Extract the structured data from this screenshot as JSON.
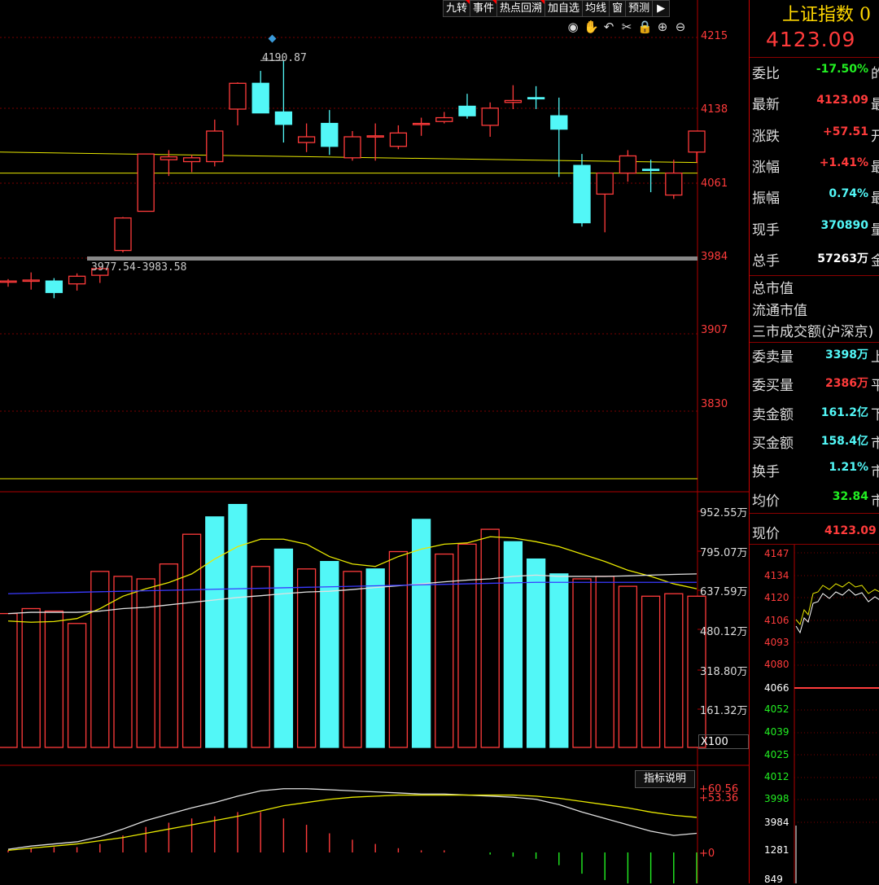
{
  "toolbar": {
    "buttons": [
      "九转",
      "事件",
      "热点回溯",
      "加自选",
      "均线",
      "窗",
      "预测"
    ],
    "exit_icon": "exit-right-icon"
  },
  "chart_tools": [
    "eye-icon",
    "hand-icon",
    "undo-icon",
    "scissors-icon",
    "lock-icon",
    "zoom-in-icon",
    "zoom-out-icon"
  ],
  "colors": {
    "up": "#ff3b3b",
    "down": "#52f7f7",
    "ma_yellow": "#e8e800",
    "ma_white": "#e0e0e0",
    "ma_blue": "#3a3aff",
    "grid": "#7a0000"
  },
  "chart_data": [
    {
      "type": "candlestick",
      "y_ticks": [
        "4215",
        "4138",
        "4061",
        "3984",
        "3907",
        "3830"
      ],
      "ylim": [
        3770,
        4240
      ],
      "annotations": {
        "high_label": "4190.87",
        "gap_label": "3977.54-3983.58"
      },
      "candles": [
        {
          "o": 3959,
          "h": 3962,
          "l": 3954,
          "c": 3960
        },
        {
          "o": 3960,
          "h": 3969,
          "l": 3951,
          "c": 3961
        },
        {
          "o": 3960,
          "h": 3963,
          "l": 3942,
          "c": 3948
        },
        {
          "o": 3957,
          "h": 3968,
          "l": 3950,
          "c": 3965
        },
        {
          "o": 3966,
          "h": 3975,
          "l": 3958,
          "c": 3973
        },
        {
          "o": 3992,
          "h": 4027,
          "l": 3990,
          "c": 4026
        },
        {
          "o": 4033,
          "h": 4093,
          "l": 4033,
          "c": 4093
        },
        {
          "o": 4087,
          "h": 4097,
          "l": 4070,
          "c": 4090
        },
        {
          "o": 4085,
          "h": 4092,
          "l": 4074,
          "c": 4089
        },
        {
          "o": 4085,
          "h": 4129,
          "l": 4080,
          "c": 4117
        },
        {
          "o": 4140,
          "h": 4168,
          "l": 4123,
          "c": 4167
        },
        {
          "o": 4167,
          "h": 4180,
          "l": 4138,
          "c": 4136
        },
        {
          "o": 4137,
          "h": 4191,
          "l": 4105,
          "c": 4124
        },
        {
          "o": 4105,
          "h": 4125,
          "l": 4095,
          "c": 4111
        },
        {
          "o": 4125,
          "h": 4139,
          "l": 4092,
          "c": 4101
        },
        {
          "o": 4089,
          "h": 4117,
          "l": 4086,
          "c": 4111
        },
        {
          "o": 4112,
          "h": 4125,
          "l": 4086,
          "c": 4112
        },
        {
          "o": 4101,
          "h": 4123,
          "l": 4098,
          "c": 4115
        },
        {
          "o": 4125,
          "h": 4131,
          "l": 4112,
          "c": 4125
        },
        {
          "o": 4127,
          "h": 4137,
          "l": 4125,
          "c": 4131
        },
        {
          "o": 4143,
          "h": 4156,
          "l": 4130,
          "c": 4133
        },
        {
          "o": 4123,
          "h": 4147,
          "l": 4111,
          "c": 4141
        },
        {
          "o": 4147,
          "h": 4165,
          "l": 4140,
          "c": 4149
        },
        {
          "o": 4152,
          "h": 4164,
          "l": 4140,
          "c": 4151
        },
        {
          "o": 4133,
          "h": 4152,
          "l": 4069,
          "c": 4119
        },
        {
          "o": 4081,
          "h": 4093,
          "l": 4017,
          "c": 4021
        },
        {
          "o": 4051,
          "h": 4073,
          "l": 4011,
          "c": 4073
        },
        {
          "o": 4073,
          "h": 4097,
          "l": 4064,
          "c": 4091
        },
        {
          "o": 4077,
          "h": 4087,
          "l": 4053,
          "c": 4076
        },
        {
          "o": 4050,
          "h": 4087,
          "l": 4046,
          "c": 4073
        },
        {
          "o": 4095,
          "h": 4116,
          "l": 4084,
          "c": 4117
        }
      ],
      "ma_lines": {
        "yellow_a": [
          4095,
          4084
        ],
        "yellow_b": [
          4073,
          4073
        ]
      }
    },
    {
      "type": "bar",
      "title": "volume",
      "y_ticks": [
        "952.55万",
        "795.07万",
        "637.59万",
        "480.12万",
        "318.80万",
        "161.32万"
      ],
      "scale_label": "X100",
      "ylim": [
        0,
        1000
      ],
      "values": [
        540,
        560,
        550,
        500,
        710,
        690,
        680,
        740,
        860,
        930,
        980,
        730,
        800,
        720,
        750,
        710,
        720,
        790,
        920,
        780,
        820,
        880,
        830,
        760,
        700,
        680,
        690,
        650,
        610,
        620,
        610
      ],
      "down_days": [
        9,
        10,
        12,
        14,
        16,
        18,
        22,
        23,
        24
      ],
      "ma_yellow": [
        510,
        505,
        508,
        520,
        560,
        610,
        640,
        665,
        700,
        760,
        810,
        840,
        840,
        820,
        770,
        740,
        730,
        770,
        800,
        820,
        825,
        850,
        845,
        830,
        810,
        780,
        750,
        715,
        690,
        660,
        640
      ],
      "ma_white": [
        540,
        545,
        545,
        545,
        550,
        560,
        565,
        575,
        585,
        595,
        605,
        612,
        620,
        627,
        630,
        637,
        645,
        652,
        660,
        668,
        675,
        680,
        690,
        695,
        690,
        690,
        690,
        692,
        695,
        698,
        700
      ],
      "ma_blue": [
        620,
        622,
        624,
        626,
        628,
        630,
        632,
        634,
        636,
        638,
        640,
        642,
        644,
        646,
        648,
        650,
        652,
        654,
        656,
        658,
        660,
        662,
        664,
        666,
        666,
        666,
        666,
        666,
        666,
        666,
        666
      ]
    },
    {
      "type": "macd",
      "y_ticks": [
        "+60.56",
        "+53.36",
        "+0"
      ],
      "dif": [
        3,
        6,
        8,
        10,
        15,
        22,
        30,
        36,
        42,
        47,
        53,
        58,
        60,
        60,
        59,
        58,
        57,
        56,
        55,
        55,
        54,
        53,
        52,
        50,
        45,
        38,
        32,
        26,
        20,
        16,
        18
      ],
      "dea": [
        2,
        4,
        6,
        8,
        11,
        14,
        18,
        22,
        26,
        30,
        34,
        39,
        44,
        47,
        50,
        52,
        53,
        54,
        54,
        54,
        54,
        54,
        54,
        53,
        51,
        48,
        45,
        42,
        38,
        35,
        33
      ],
      "hist": [
        2,
        4,
        5,
        5,
        8,
        16,
        24,
        28,
        32,
        34,
        38,
        38,
        32,
        26,
        18,
        12,
        8,
        4,
        2,
        2,
        0,
        -2,
        -4,
        -6,
        -12,
        -20,
        -26,
        -32,
        -36,
        -38,
        -30
      ]
    }
  ],
  "panel": {
    "title": "上证指数 0",
    "price": "4123.09",
    "rows": [
      {
        "label": "委比",
        "value": "-17.50%",
        "trail": "的",
        "color": "#22ee22"
      },
      {
        "label": "最新",
        "value": "4123.09",
        "trail": "最",
        "color": "#ff3b3b"
      },
      {
        "label": "涨跌",
        "value": "+57.51",
        "trail": "开",
        "color": "#ff3b3b"
      },
      {
        "label": "涨幅",
        "value": "+1.41%",
        "trail": "最",
        "color": "#ff3b3b"
      },
      {
        "label": "振幅",
        "value": "0.74%",
        "trail": "最",
        "color": "#52f7f7"
      },
      {
        "label": "现手",
        "value": "370890",
        "trail": "量",
        "color": "#52f7f7"
      },
      {
        "label": "总手",
        "value": "57263万",
        "trail": "金",
        "color": "#ffffff"
      }
    ],
    "plain_labels": [
      "总市值",
      "流通市值",
      "三市成交额(沪深京)"
    ],
    "rows2": [
      {
        "label": "委卖量",
        "value": "3398万",
        "trail": "上",
        "color": "#52f7f7"
      },
      {
        "label": "委买量",
        "value": "2386万",
        "trail": "平",
        "color": "#ff3b3b"
      },
      {
        "label": "卖金额",
        "value": "161.2亿",
        "trail": "下",
        "color": "#52f7f7"
      },
      {
        "label": "买金额",
        "value": "158.4亿",
        "trail": "市",
        "color": "#52f7f7"
      },
      {
        "label": "换手",
        "value": "1.21%",
        "trail": "市",
        "color": "#52f7f7"
      },
      {
        "label": "均价",
        "value": "32.84",
        "trail": "市",
        "color": "#22ee22"
      }
    ],
    "current_label": "现价",
    "current_value": "4123.09",
    "mini_ticks": [
      "4147",
      "4134",
      "4120",
      "4106",
      "4093",
      "4080",
      "4066",
      "4052",
      "4039",
      "4025",
      "4012",
      "3998",
      "3984",
      "1281",
      "849"
    ]
  },
  "indicator_button": "指标说明"
}
